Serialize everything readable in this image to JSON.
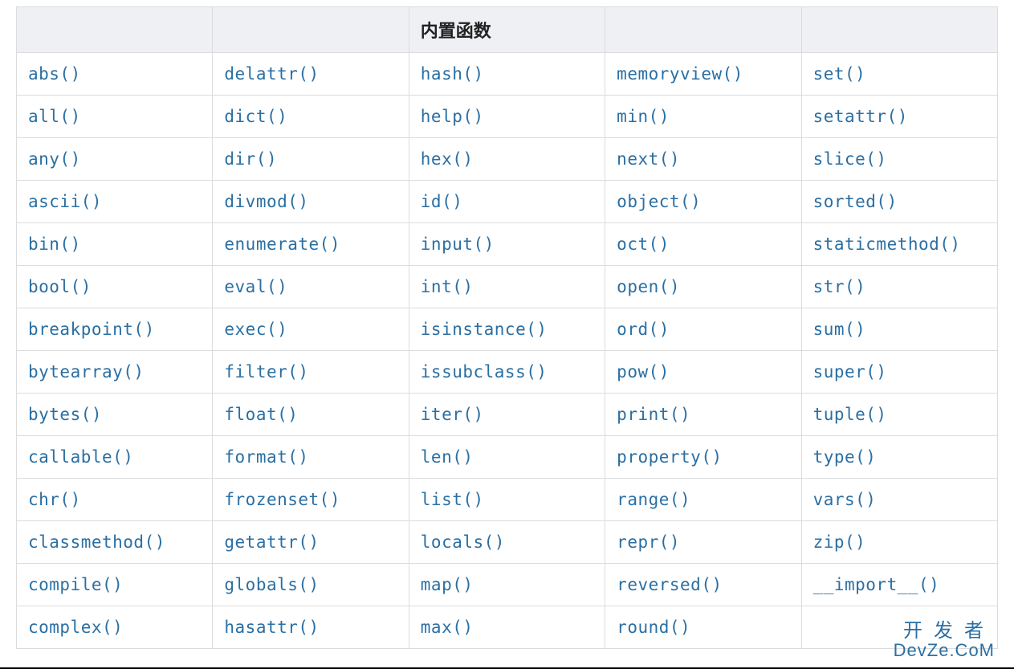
{
  "table": {
    "header": [
      "",
      "",
      "内置函数",
      "",
      ""
    ],
    "rows": [
      [
        "abs()",
        "delattr()",
        "hash()",
        "memoryview()",
        "set()"
      ],
      [
        "all()",
        "dict()",
        "help()",
        "min()",
        "setattr()"
      ],
      [
        "any()",
        "dir()",
        "hex()",
        "next()",
        "slice()"
      ],
      [
        "ascii()",
        "divmod()",
        "id()",
        "object()",
        "sorted()"
      ],
      [
        "bin()",
        "enumerate()",
        "input()",
        "oct()",
        "staticmethod()"
      ],
      [
        "bool()",
        "eval()",
        "int()",
        "open()",
        "str()"
      ],
      [
        "breakpoint()",
        "exec()",
        "isinstance()",
        "ord()",
        "sum()"
      ],
      [
        "bytearray()",
        "filter()",
        "issubclass()",
        "pow()",
        "super()"
      ],
      [
        "bytes()",
        "float()",
        "iter()",
        "print()",
        "tuple()"
      ],
      [
        "callable()",
        "format()",
        "len()",
        "property()",
        "type()"
      ],
      [
        "chr()",
        "frozenset()",
        "list()",
        "range()",
        "vars()"
      ],
      [
        "classmethod()",
        "getattr()",
        "locals()",
        "repr()",
        "zip()"
      ],
      [
        "compile()",
        "globals()",
        "map()",
        "reversed()",
        "__import__()"
      ],
      [
        "complex()",
        "hasattr()",
        "max()",
        "round()",
        ""
      ]
    ]
  },
  "watermark": {
    "line1": "开发者",
    "line2": "DevZe.CoM"
  }
}
